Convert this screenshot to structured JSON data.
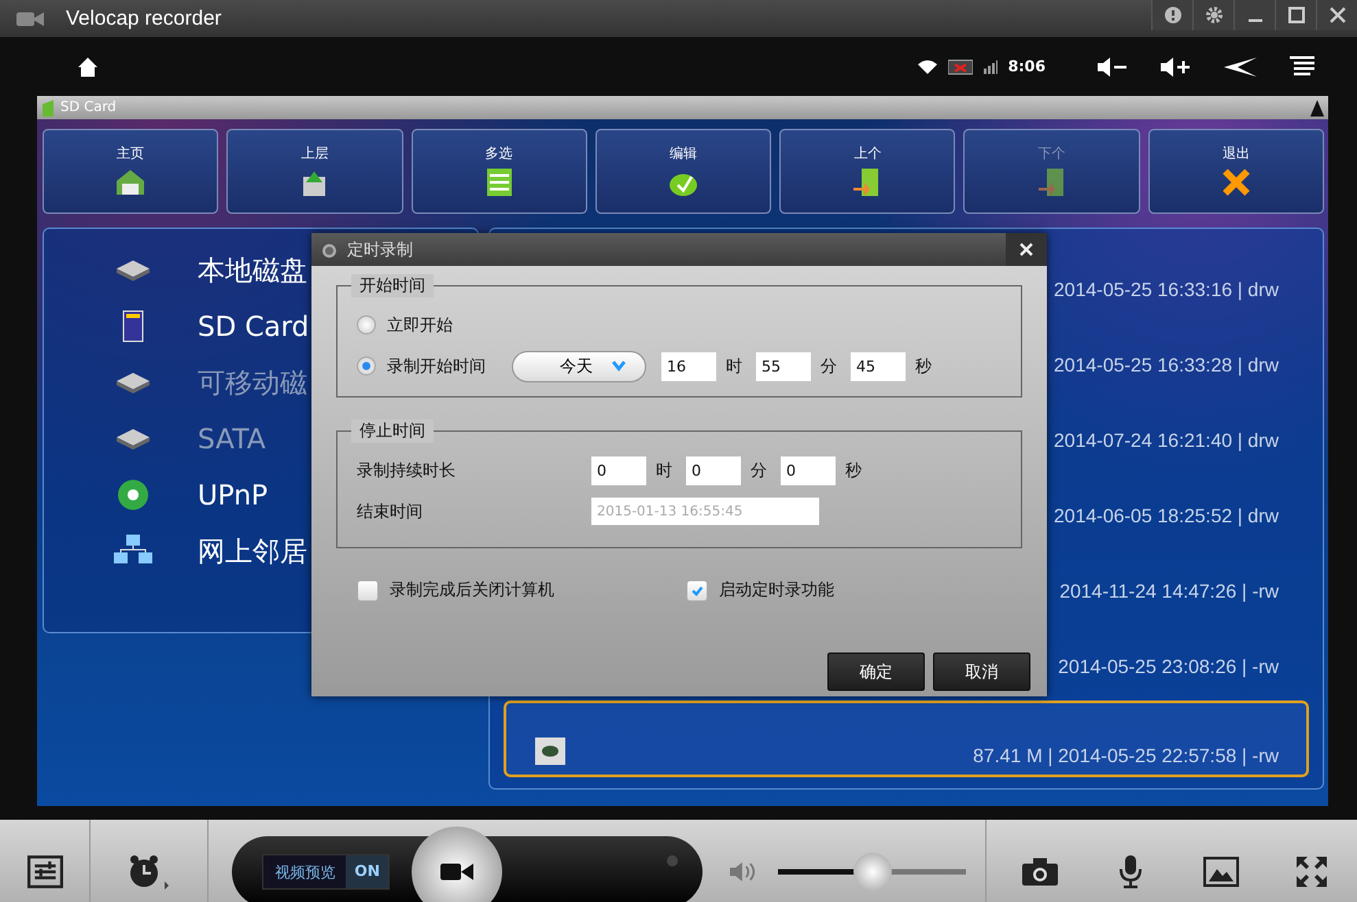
{
  "window": {
    "title": "Velocap recorder"
  },
  "status_bar": {
    "time": "8:06"
  },
  "location": {
    "title": "SD Card"
  },
  "toolbar": [
    {
      "label": "主页",
      "kind": "home",
      "disabled": false
    },
    {
      "label": "上层",
      "kind": "up",
      "disabled": false
    },
    {
      "label": "多选",
      "kind": "multi",
      "disabled": false
    },
    {
      "label": "编辑",
      "kind": "edit",
      "disabled": false
    },
    {
      "label": "上个",
      "kind": "prev",
      "disabled": false
    },
    {
      "label": "下个",
      "kind": "next",
      "disabled": true
    },
    {
      "label": "退出",
      "kind": "exit",
      "disabled": false
    }
  ],
  "drives": [
    {
      "label": "本地磁盘",
      "kind": "disk",
      "disabled": false
    },
    {
      "label": "SD Card",
      "kind": "sd",
      "disabled": false
    },
    {
      "label": "可移动磁",
      "kind": "disk",
      "disabled": true
    },
    {
      "label": "SATA",
      "kind": "disk",
      "disabled": true
    },
    {
      "label": "UPnP",
      "kind": "upnp",
      "disabled": false
    },
    {
      "label": "网上邻居",
      "kind": "network",
      "disabled": false
    }
  ],
  "files": [
    {
      "info": "2014-05-25 16:33:16 | drw",
      "selected": false
    },
    {
      "info": "2014-05-25 16:33:28 | drw",
      "selected": false
    },
    {
      "info": "2014-07-24 16:21:40 | drw",
      "selected": false
    },
    {
      "info": "2014-06-05 18:25:52 | drw",
      "selected": false
    },
    {
      "info": "2014-11-24 14:47:26 | -rw",
      "selected": false
    },
    {
      "info": "2014-05-25 23:08:26 | -rw",
      "selected": false
    },
    {
      "info": "87.41 M | 2014-05-25 22:57:58 | -rw",
      "selected": true
    }
  ],
  "dialog": {
    "title": "定时录制",
    "start_group": "开始时间",
    "start_options": [
      {
        "label": "立即开始",
        "selected": false
      },
      {
        "label": "录制开始时间",
        "selected": true
      }
    ],
    "day": "今天",
    "start_fields": [
      {
        "value": "16",
        "unit": "时"
      },
      {
        "value": "55",
        "unit": "分"
      },
      {
        "value": "45",
        "unit": "秒"
      }
    ],
    "stop_group": "停止时间",
    "duration_label": "录制持续时长",
    "duration_fields": [
      {
        "value": "0",
        "unit": "时"
      },
      {
        "value": "0",
        "unit": "分"
      },
      {
        "value": "0",
        "unit": "秒"
      }
    ],
    "end_label": "结束时间",
    "end_time": "2015-01-13 16:55:45",
    "options": [
      {
        "label": "录制完成后关闭计算机",
        "checked": false
      },
      {
        "label": "启动定时录功能",
        "checked": true
      }
    ],
    "buttons": [
      "确定",
      "取消"
    ]
  },
  "bottom": {
    "preview_label": "视频预览",
    "preview_state": "ON",
    "volume": {
      "level": 0.5
    }
  }
}
